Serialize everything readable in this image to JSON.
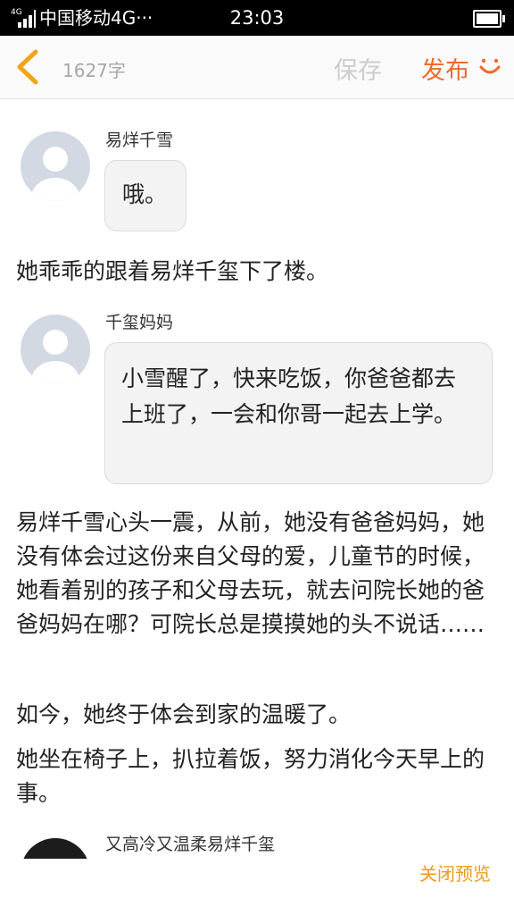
{
  "status_bar": {
    "network_tag": "4G",
    "carrier": "中国移动4G···",
    "time": "23:03"
  },
  "header": {
    "word_count": "1627字",
    "save_label": "保存",
    "publish_label": "发布"
  },
  "story": {
    "dialogue1": {
      "speaker": "易烊千雪",
      "text": "哦。"
    },
    "narration1": "她乖乖的跟着易烊千玺下了楼。",
    "dialogue2": {
      "speaker": "千玺妈妈",
      "text": "小雪醒了，快来吃饭，你爸爸都去上班了，一会和你哥一起去上学。"
    },
    "narration2": "易烊千雪心头一震，从前，她没有爸爸妈妈，她没有体会过这份来自父母的爱，儿童节的时候，她看着别的孩子和父母去玩，就去问院长她的爸爸妈妈在哪？可院长总是摸摸她的头不说话……",
    "narration3": "如今，她终于体会到家的温暖了。",
    "narration4": "她坐在椅子上，扒拉着饭，努力消化今天早上的事。",
    "dialogue3": {
      "speaker": "又高冷又温柔易烊千玺"
    }
  },
  "footer": {
    "close_preview_label": "关闭预览"
  },
  "colors": {
    "accent": "#ee6a2b",
    "close_preview": "#ef9b1b"
  }
}
